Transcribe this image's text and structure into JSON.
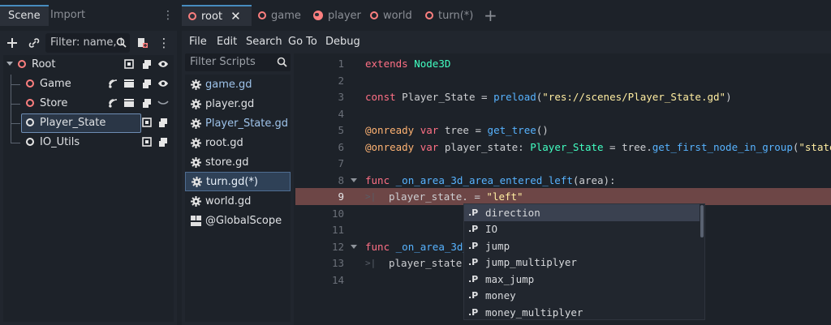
{
  "scene_dock": {
    "tabs": [
      "Scene",
      "Import"
    ],
    "filter_placeholder": "Filter: name, t",
    "tree": [
      {
        "label": "Root",
        "icon": "node3d-ring",
        "color": "#fc7f7f"
      },
      {
        "label": "Game",
        "icon": "node3d-ring",
        "color": "#fc7f7f"
      },
      {
        "label": "Store",
        "icon": "node3d-ring",
        "color": "#fc7f7f"
      },
      {
        "label": "Player_State",
        "icon": "node-ring",
        "color": "#e6e6e6"
      },
      {
        "label": "IO_Utils",
        "icon": "node-ring",
        "color": "#e6e6e6"
      }
    ]
  },
  "editor_tabs": [
    {
      "label": "root",
      "active": true
    },
    {
      "label": "game"
    },
    {
      "label": "player",
      "icon": "globe-icon"
    },
    {
      "label": "world"
    },
    {
      "label": "turn(*)"
    }
  ],
  "menu": [
    "File",
    "Edit",
    "Search",
    "Go To",
    "Debug"
  ],
  "script_panel": {
    "filter_placeholder": "Filter Scripts",
    "scripts": [
      {
        "label": "game.gd",
        "tool": true
      },
      {
        "label": "player.gd"
      },
      {
        "label": "Player_State.gd",
        "tool": true
      },
      {
        "label": "root.gd"
      },
      {
        "label": "store.gd"
      },
      {
        "label": "turn.gd(*)",
        "selected": true
      },
      {
        "label": "world.gd"
      },
      {
        "label": "@GlobalScope",
        "icon": "doc-icon"
      }
    ]
  },
  "code": {
    "line_numbers": [
      "1",
      "2",
      "3",
      "4",
      "5",
      "6",
      "7",
      "8",
      "9",
      "10",
      "11",
      "12",
      "13",
      "14"
    ],
    "current_line": "9",
    "l1": {
      "kw": "extends",
      "type": "Node3D"
    },
    "l3": {
      "kw": "const",
      "name": "Player_State",
      "eq": " = ",
      "fn": "preload",
      "open": "(",
      "str": "\"res://scenes/Player_State.gd\"",
      "close": ")"
    },
    "l5": {
      "ann": "@onready",
      "kw": "var",
      "rest": " tree = ",
      "fn": "get_tree",
      "paren": "()"
    },
    "l6": {
      "ann": "@onready",
      "kw": "var",
      "rest": " player_state: ",
      "type": "Player_State",
      "rest2": " = tree.",
      "fn": "get_first_node_in_group",
      "open": "(",
      "str": "\"state\"",
      "close": ")"
    },
    "l8": {
      "kw": "func",
      "fn": "_on_area_3d_area_entered_left",
      "rest": "(area):"
    },
    "l9": {
      "rest": "player_state. = ",
      "str": "\"left\""
    },
    "l12": {
      "kw": "func",
      "fn": "_on_area_3d_"
    },
    "l13": {
      "rest": "player_state."
    }
  },
  "autocomplete": {
    "kind": ".P",
    "items": [
      "direction",
      "IO",
      "jump",
      "jump_multiplyer",
      "max_jump",
      "money",
      "money_multiplyer"
    ]
  },
  "colors": {
    "accent": "#478cbf",
    "node3d": "#fc7f7f",
    "error_line": "#6d4646"
  }
}
